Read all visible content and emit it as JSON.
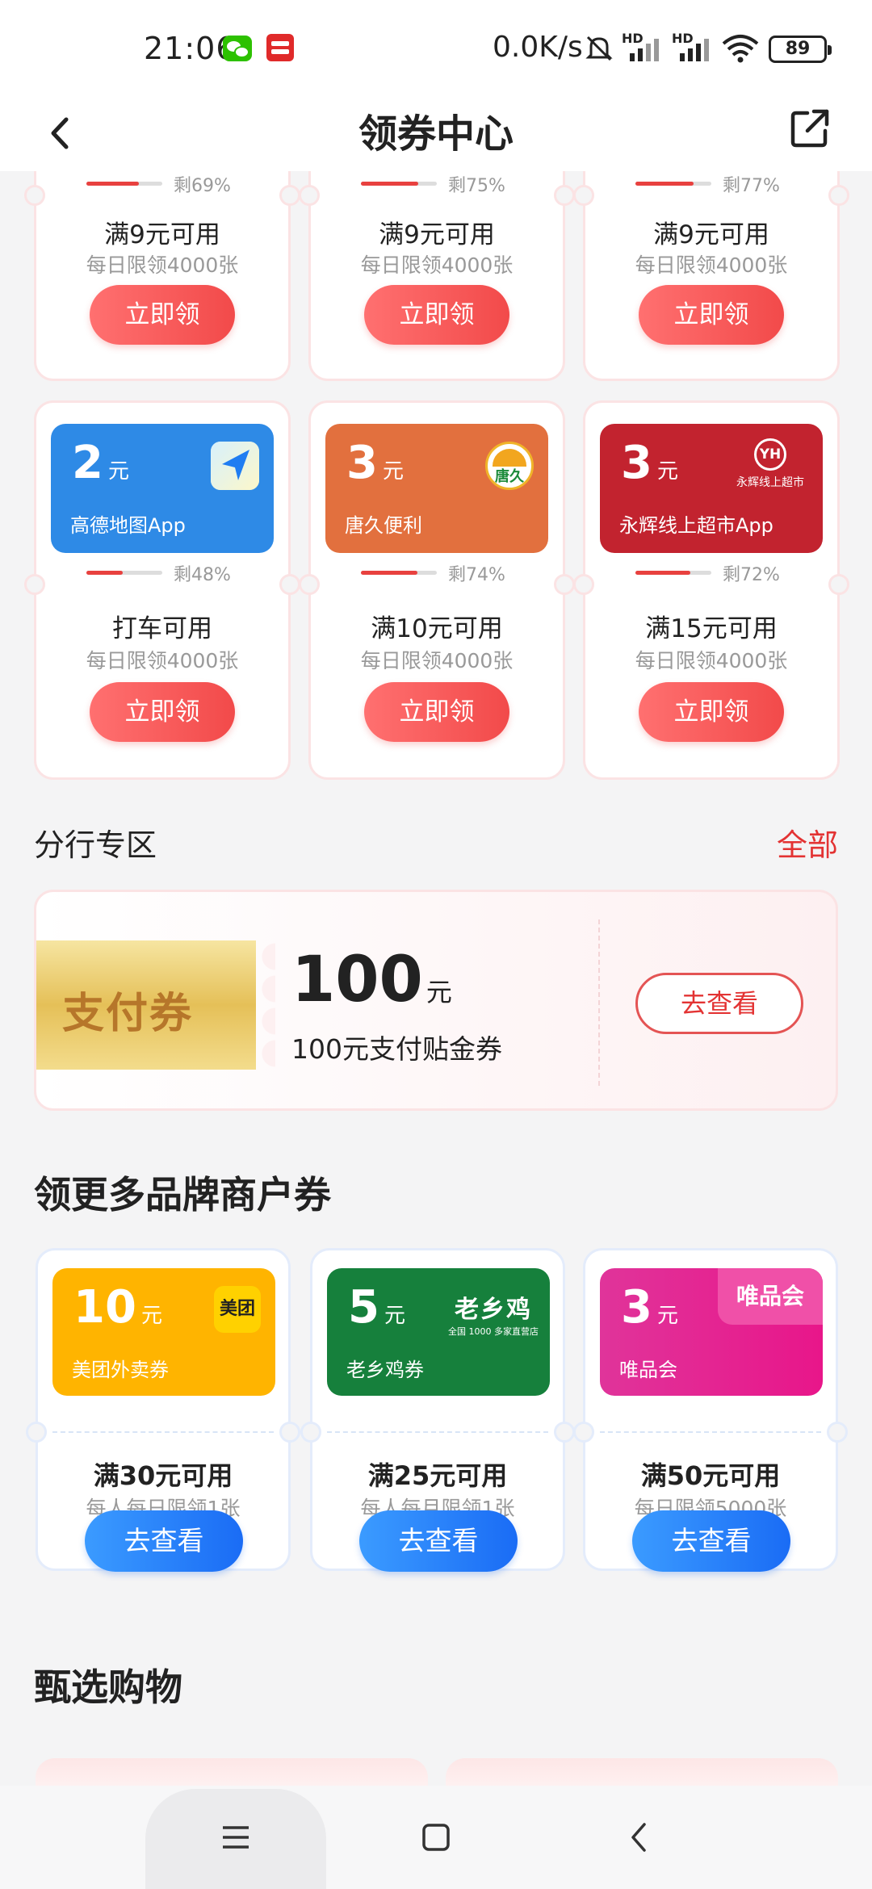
{
  "status_bar": {
    "time": "21:06",
    "net_speed": "0.0K/s",
    "hd_label": "HD",
    "battery": "89",
    "icons": [
      "wechat-icon",
      "app-notification-icon",
      "mute-icon",
      "signal-icon",
      "signal-icon",
      "wifi-icon",
      "battery-icon"
    ]
  },
  "header": {
    "title": "领券中心",
    "back_icon": "chevron-left-icon",
    "share_icon": "share-icon"
  },
  "top_row_coupons": [
    {
      "remaining": "剩69%",
      "remaining_pct": 69,
      "condition": "满9元可用",
      "limit": "每日限领4000张",
      "button": "立即领"
    },
    {
      "remaining": "剩75%",
      "remaining_pct": 75,
      "condition": "满9元可用",
      "limit": "每日限领4000张",
      "button": "立即领"
    },
    {
      "remaining": "剩77%",
      "remaining_pct": 77,
      "condition": "满9元可用",
      "limit": "每日限领4000张",
      "button": "立即领"
    }
  ],
  "second_row_coupons": [
    {
      "amount": "2",
      "unit": "元",
      "brand": "高德地图App",
      "color": "#2e8ae6",
      "remaining": "剩48%",
      "remaining_pct": 48,
      "condition": "打车可用",
      "limit": "每日限领4000张",
      "button": "立即领"
    },
    {
      "amount": "3",
      "unit": "元",
      "brand": "唐久便利",
      "color": "#e2703e",
      "logo_text": "唐久",
      "remaining": "剩74%",
      "remaining_pct": 74,
      "condition": "满10元可用",
      "limit": "每日限领4000张",
      "button": "立即领"
    },
    {
      "amount": "3",
      "unit": "元",
      "brand": "永辉线上超市App",
      "color": "#c2232f",
      "logo_text": "YH",
      "logo_sub": "永辉线上超市",
      "remaining": "剩72%",
      "remaining_pct": 72,
      "condition": "满15元可用",
      "limit": "每日限领4000张",
      "button": "立即领"
    }
  ],
  "branch_section": {
    "title": "分行专区",
    "link": "全部",
    "card": {
      "image_text": "支付券",
      "amount": "100",
      "unit": "元",
      "description": "100元支付贴金券",
      "button": "去查看"
    }
  },
  "merchant_section": {
    "title": "领更多品牌商户券",
    "coupons": [
      {
        "amount": "10",
        "unit": "元",
        "brand": "美团外卖券",
        "color": "#ffb400",
        "logo_text": "美团",
        "condition": "满30元可用",
        "limit": "每人每日限领1张",
        "button": "去查看"
      },
      {
        "amount": "5",
        "unit": "元",
        "brand": "老乡鸡券",
        "color": "#16803c",
        "logo_text": "老乡鸡",
        "logo_sub": "全国 1000 多家直营店",
        "condition": "满25元可用",
        "limit": "每人每月限领1张",
        "button": "去查看"
      },
      {
        "amount": "3",
        "unit": "元",
        "brand": "唯品会",
        "color": "#e8168a",
        "logo_text": "唯品会",
        "condition": "满50元可用",
        "limit": "每日限领5000张",
        "button": "去查看"
      }
    ]
  },
  "shopping_section": {
    "title": "甄选购物"
  },
  "system_nav": {
    "icons": [
      "menu-icon",
      "home-icon",
      "back-icon"
    ]
  }
}
